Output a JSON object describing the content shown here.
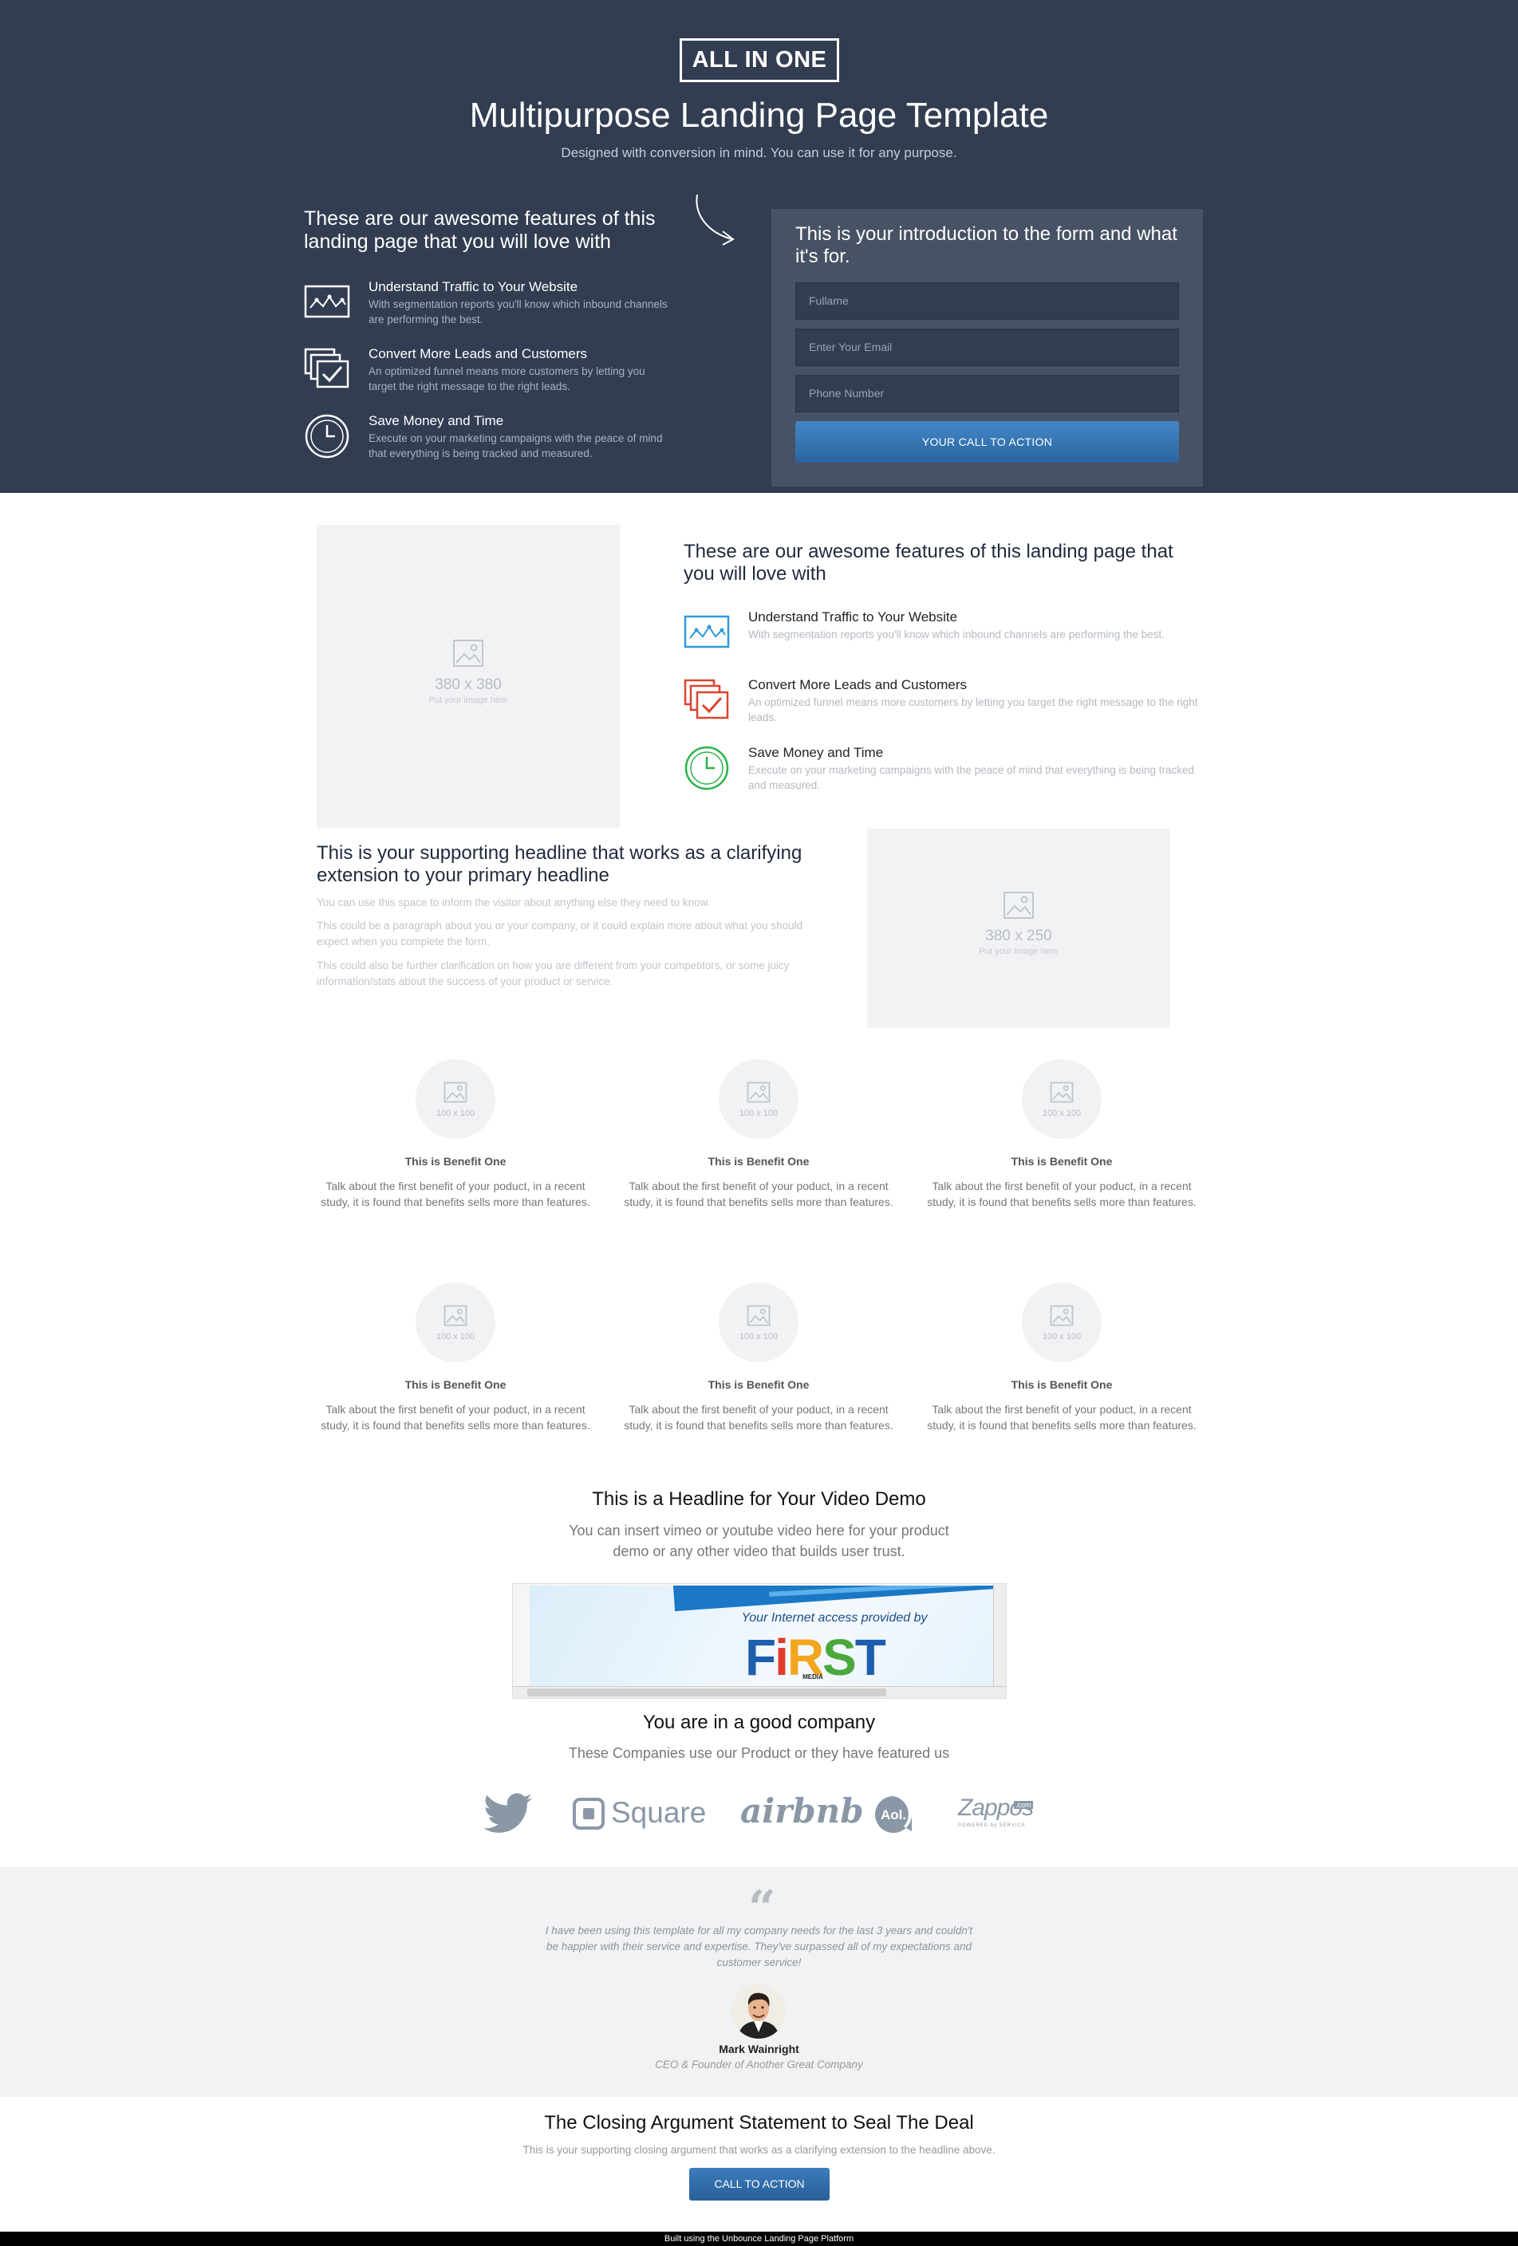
{
  "hero": {
    "logo": "ALL IN ONE",
    "title": "Multipurpose Landing Page Template",
    "subtitle": "Designed with conversion in mind. You can use it for any purpose.",
    "features_heading": "These are our awesome features of this landing page that you will love with",
    "features": [
      {
        "icon": "line-chart-icon",
        "title": "Understand Traffic to Your Website",
        "desc": "With segmentation reports you'll know which inbound channels are performing the best."
      },
      {
        "icon": "stacked-check-icon",
        "title": "Convert More Leads and Customers",
        "desc": "An optimized funnel means more customers by letting you target the right message to the right leads."
      },
      {
        "icon": "clock-icon",
        "title": "Save Money and Time",
        "desc": "Execute on your marketing campaigns with the peace of mind that everything is being tracked and measured."
      }
    ]
  },
  "form": {
    "intro": "This is your introduction to the form and what it's for.",
    "fullname_placeholder": "Fullame",
    "email_placeholder": "Enter Your Email",
    "phone_placeholder": "Phone Number",
    "cta_label": "YOUR CALL TO ACTION"
  },
  "image_main": {
    "size": "380 x 380",
    "hint": "Put your image here"
  },
  "features_light": {
    "heading": "These are our awesome features of this landing page that you will love with",
    "items": [
      {
        "icon": "line-chart-icon",
        "color": "#2f9ad8",
        "title": "Understand Traffic to Your Website",
        "desc": "With segmentation reports you'll know which inbound channels are performing the best."
      },
      {
        "icon": "stacked-check-icon",
        "color": "#d9452d",
        "title": "Convert More Leads and Customers",
        "desc": "An optimized funnel means more customers by letting you target the right message to the right leads."
      },
      {
        "icon": "clock-icon",
        "color": "#2bb34a",
        "title": "Save Money and Time",
        "desc": "Execute on your marketing campaigns with the peace of mind that everything is being tracked and measured."
      }
    ]
  },
  "support": {
    "heading": "This is your supporting headline that works as a clarifying extension to your primary headline",
    "paragraphs": [
      "You can use this space to inform the visitor about anything else they need to know.",
      "This could be a paragraph about you or your company, or it could explain more about what you should expect when you complete the form.",
      "This could also be further clarification on how you are different from your competitors, or some juicy information/stats about the success of your product or service."
    ],
    "image": {
      "size": "380 x 250",
      "hint": "Put your image here"
    }
  },
  "benefits": [
    {
      "img": "100 x 100",
      "title": "This is Benefit One",
      "desc": "Talk about the first benefit of your poduct, in a recent study, it is found that benefits sells more than features."
    },
    {
      "img": "100 x 100",
      "title": "This is Benefit One",
      "desc": "Talk about the first benefit of your poduct, in a recent study, it is found that benefits sells more than features."
    },
    {
      "img": "100 x 100",
      "title": "This is Benefit One",
      "desc": "Talk about the first benefit of your poduct, in a recent study, it is found that benefits sells more than features."
    },
    {
      "img": "100 x 100",
      "title": "This is Benefit One",
      "desc": "Talk about the first benefit of your poduct, in a recent study, it is found that benefits sells more than features."
    },
    {
      "img": "100 x 100",
      "title": "This is Benefit One",
      "desc": "Talk about the first benefit of your poduct, in a recent study, it is found that benefits sells more than features."
    },
    {
      "img": "100 x 100",
      "title": "This is Benefit One",
      "desc": "Talk about the first benefit of your poduct, in a recent study, it is found that benefits sells more than features."
    }
  ],
  "video": {
    "heading": "This is a Headline for Your Video Demo",
    "sub": "You can insert vimeo or youtube video here for your product demo or any other video that builds user trust.",
    "provider_text": "Your Internet access provided by",
    "brand": [
      "F",
      "i",
      "R",
      "S",
      "T"
    ],
    "brand_sub": "MEDIA"
  },
  "company": {
    "heading": "You are in a good company",
    "sub": "These Companies use our Product or they have featured us",
    "logos": [
      {
        "icon": "twitter-bird-icon"
      },
      {
        "icon": "square-logo-icon",
        "text": "Square"
      },
      {
        "icon": "airbnb-logo",
        "text": "airbnb"
      },
      {
        "icon": "aol-logo-icon",
        "text": "Aol."
      },
      {
        "icon": "zappos-logo",
        "text": "Zappos",
        "tag": ".com",
        "sub": "POWERED by SERVICE"
      }
    ]
  },
  "testimonial": {
    "quote_mark": "“",
    "quote": "I have been using this template for all my company needs for the last 3 years and couldn't be happier with their service and expertise. They've surpassed all of my expectations and customer service!",
    "name": "Mark Wainright",
    "role": "CEO & Founder of Another Great Company"
  },
  "closing": {
    "heading": "The Closing Argument Statement to Seal The Deal",
    "sub": "This is your supporting closing argument that works as a clarifying extension to the headline above.",
    "button": "CALL TO ACTION"
  },
  "footer": {
    "text": "Built using the Unbounce Landing Page Platform"
  }
}
